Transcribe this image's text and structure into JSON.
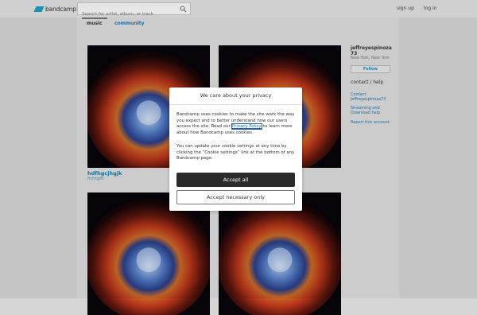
{
  "topbar": {
    "logo_text": "bandcamp",
    "search_placeholder": "Search for artist, album, or track",
    "signup": "sign up",
    "login": "log in"
  },
  "tabs": [
    {
      "label": "music",
      "active": true
    },
    {
      "label": "community",
      "active": false
    }
  ],
  "albums": [
    {
      "title": "hdfhgcjhgjk",
      "artist": "fhfrtgfh"
    }
  ],
  "sidebar": {
    "name": "jeffreyespinoza73",
    "location": "New York, New York",
    "follow": "Follow",
    "contact_heading": "contact / help",
    "links": [
      "Contact jeffreyespinoza73",
      "Streaming and Download help",
      "Report this account"
    ]
  },
  "modal": {
    "title": "We care about your privacy",
    "p1_before": "Bandcamp uses cookies to make the site work the way you expect and to better understand how our users access the site. Read our ",
    "p1_link": "Privacy Policy",
    "p1_after": " to learn more about how Bandcamp uses cookies.",
    "p2": "You can update your cookie settings at any time by clicking the “Cookie settings” link at the bottom of any Bandcamp page.",
    "accept_all": "Accept all",
    "accept_necessary": "Accept necessary only"
  },
  "colors": {
    "accent_link": "#0e7fb0",
    "logo": "#1da0c3"
  },
  "icons": [
    "search-icon",
    "bandcamp-logo-icon"
  ]
}
